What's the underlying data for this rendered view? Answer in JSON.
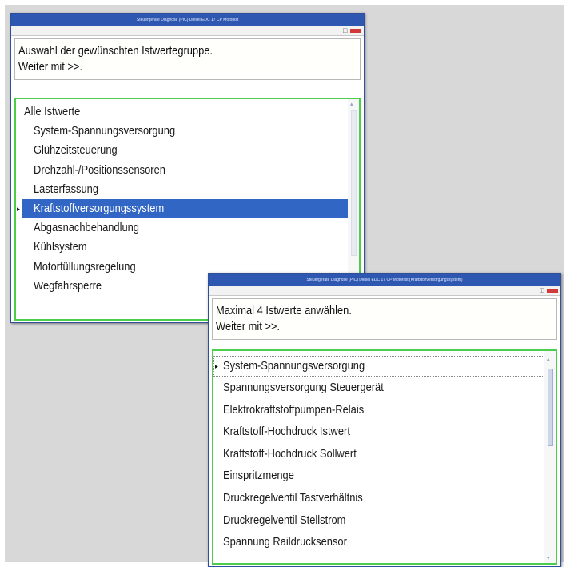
{
  "window1": {
    "title": "Steuergeräte Diagnose (PIC) Diesel EDC 17 CP Motorlist",
    "instruction_line1": "Auswahl der gewünschten Istwertegruppe.",
    "instruction_line2": "Weiter mit >>.",
    "items": [
      "Alle Istwerte",
      "System-Spannungsversorgung",
      "Glühzeitsteuerung",
      "Drehzahl-/Positionssensoren",
      "Lasterfassung",
      "Kraftstoffversorgungssystem",
      "Abgasnachbehandlung",
      "Kühlsystem",
      "Motorfüllungsregelung",
      "Wegfahrsperre"
    ],
    "selected_item": "Kraftstoffversorgungssystem"
  },
  "window2": {
    "title": "Steuergeräte Diagnose (PIC) Diesel EDC 17 CP Motorlist (Kraftstoffversorgungssystem)",
    "instruction_line1": "Maximal 4 Istwerte anwählen.",
    "instruction_line2": "Weiter mit >>.",
    "items": [
      "System-Spannungsversorgung",
      "Spannungsversorgung Steuergerät",
      "Elektrokraftstoffpumpen-Relais",
      "Kraftstoff-Hochdruck Istwert",
      "Kraftstoff-Hochdruck Sollwert",
      "Einspritzmenge",
      "Druckregelventil Tastverhältnis",
      "Druckregelventil Stellstrom",
      "Spannung Raildrucksensor"
    ],
    "focused_item": "System-Spannungsversorgung"
  },
  "colors": {
    "titlebar": "#2d57b0",
    "selection": "#3166c4",
    "list_frame": "#4ccd4c",
    "close_button": "#d23a3a"
  },
  "icons": [
    "close-icon",
    "minimize-icon",
    "row-marker-icon",
    "scroll-up-icon",
    "scroll-down-icon"
  ]
}
